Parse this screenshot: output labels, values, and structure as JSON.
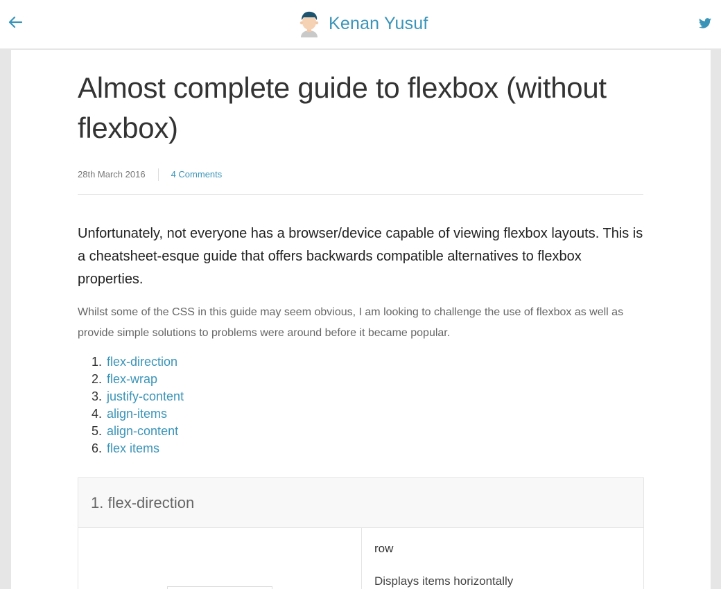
{
  "header": {
    "site_name": "Kenan Yusuf",
    "back_icon": "arrow-left-icon",
    "social_icon": "twitter-icon",
    "accent_color": "#3a94b8"
  },
  "article": {
    "title": "Almost complete guide to flexbox (without flexbox)",
    "date": "28th March 2016",
    "comments": "4 Comments",
    "lead": "Unfortunately, not everyone has a browser/device capable of viewing flexbox layouts. This is a cheatsheet-esque guide that offers backwards compatible alternatives to flexbox properties.",
    "intro": "Whilst some of the CSS in this guide may seem obvious, I am looking to challenge the use of flexbox as well as provide simple solutions to problems were around before it became popular.",
    "toc": [
      {
        "num": "1.",
        "label": "flex-direction"
      },
      {
        "num": "2.",
        "label": "flex-wrap"
      },
      {
        "num": "3.",
        "label": "justify-content"
      },
      {
        "num": "4.",
        "label": "align-items"
      },
      {
        "num": "5.",
        "label": "align-content"
      },
      {
        "num": "6.",
        "label": "flex items"
      }
    ]
  },
  "section": {
    "heading": "1. flex-direction",
    "property_value": "row",
    "description": "Displays items horizontally"
  }
}
